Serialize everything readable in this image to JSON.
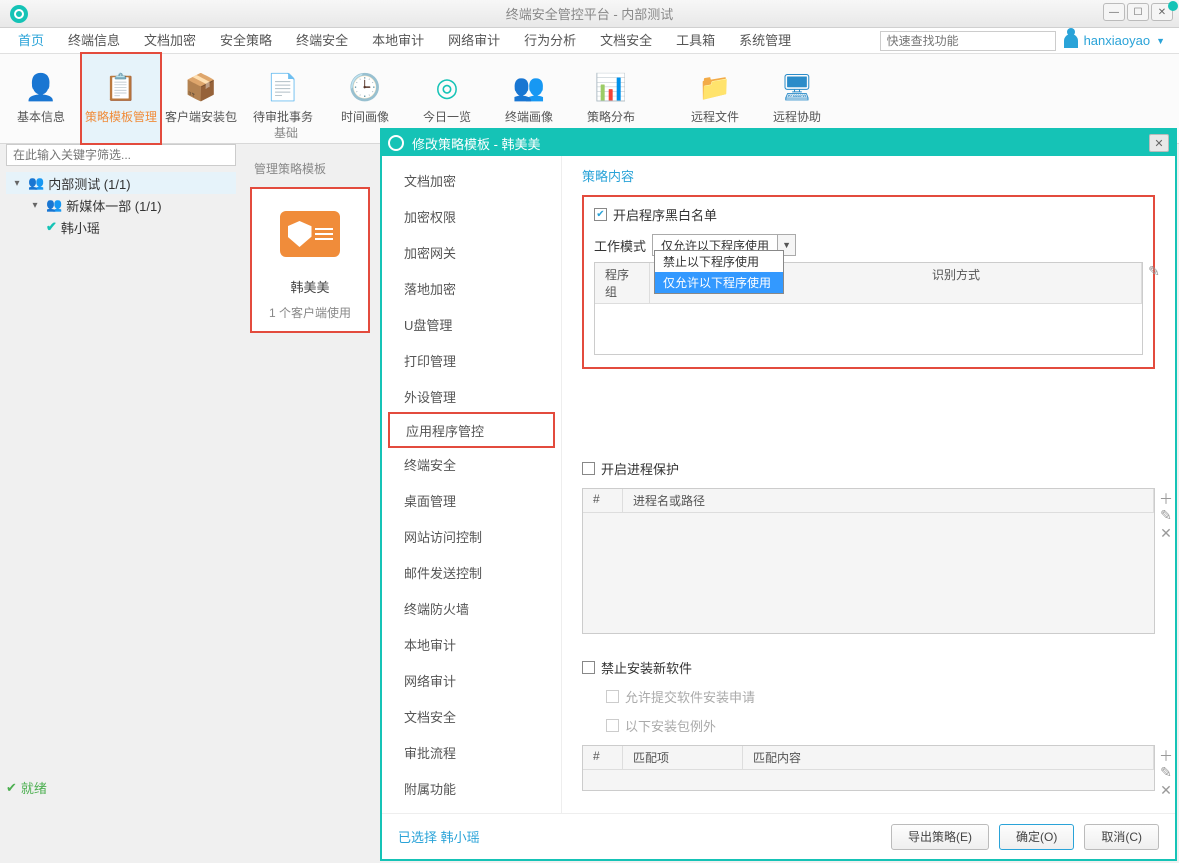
{
  "window": {
    "title": "终端安全管控平台 - 内部测试",
    "username": "hanxiaoyao"
  },
  "menu": {
    "tabs": [
      "首页",
      "终端信息",
      "文档加密",
      "安全策略",
      "终端安全",
      "本地审计",
      "网络审计",
      "行为分析",
      "文档安全",
      "工具箱",
      "系统管理"
    ],
    "search_placeholder": "快速查找功能"
  },
  "ribbon": {
    "group_label": "基础",
    "items": [
      {
        "label": "基本信息",
        "icon": "👤",
        "cls": "ri-user"
      },
      {
        "label": "策略模板管理",
        "icon": "📋",
        "cls": "ri-doc",
        "active": true
      },
      {
        "label": "客户端安装包",
        "icon": "📦",
        "cls": "ri-folder"
      },
      {
        "label": "待审批事务",
        "icon": "📄",
        "cls": "ri-file"
      },
      {
        "label": "时间画像",
        "icon": "🕒",
        "cls": "ri-clock"
      },
      {
        "label": "今日一览",
        "icon": "◎",
        "cls": "ri-eye"
      },
      {
        "label": "终端画像",
        "icon": "👥",
        "cls": "ri-cal"
      },
      {
        "label": "策略分布",
        "icon": "📊",
        "cls": "ri-pie"
      },
      {
        "label": "远程文件",
        "icon": "📁",
        "cls": "ri-remote-file"
      },
      {
        "label": "远程协助",
        "icon": "🖥",
        "cls": "ri-remote"
      }
    ]
  },
  "left": {
    "filter_placeholder": "在此输入关键字筛选...",
    "tree": [
      {
        "label": "内部测试 (1/1)",
        "level": 0,
        "icon": "group",
        "expand": "▾",
        "sel": true
      },
      {
        "label": "新媒体一部 (1/1)",
        "level": 1,
        "icon": "group",
        "expand": "▾"
      },
      {
        "label": "韩小瑶",
        "level": 2,
        "icon": "check"
      }
    ],
    "status": "就绪"
  },
  "mid": {
    "title": "管理策略模板",
    "card_name": "韩美美",
    "card_count": "1 个客户端使用"
  },
  "dialog": {
    "title": "修改策略模板 - 韩美美",
    "nav": [
      "文档加密",
      "加密权限",
      "加密网关",
      "落地加密",
      "U盘管理",
      "打印管理",
      "外设管理",
      "应用程序管控",
      "终端安全",
      "桌面管理",
      "网站访问控制",
      "邮件发送控制",
      "终端防火墙",
      "本地审计",
      "网络审计",
      "文档安全",
      "审批流程",
      "附属功能"
    ],
    "nav_active": "应用程序管控",
    "content_title": "策略内容",
    "s1": {
      "chk_label": "开启程序黑白名单",
      "mode_label": "工作模式",
      "mode_value": "仅允许以下程序使用",
      "dropdown": [
        "禁止以下程序使用",
        "仅允许以下程序使用"
      ],
      "tbl_cols": [
        "程序组",
        "识别方式"
      ]
    },
    "s2": {
      "chk_label": "开启进程保护",
      "tbl_cols": [
        "#",
        "进程名或路径"
      ]
    },
    "s3": {
      "chk_label": "禁止安装新软件",
      "sub1": "允许提交软件安装申请",
      "sub2": "以下安装包例外",
      "tbl_cols": [
        "#",
        "匹配项",
        "匹配内容"
      ]
    },
    "footer": {
      "selected": "已选择 韩小瑶",
      "export": "导出策略(E)",
      "ok": "确定(O)",
      "cancel": "取消(C)"
    }
  }
}
